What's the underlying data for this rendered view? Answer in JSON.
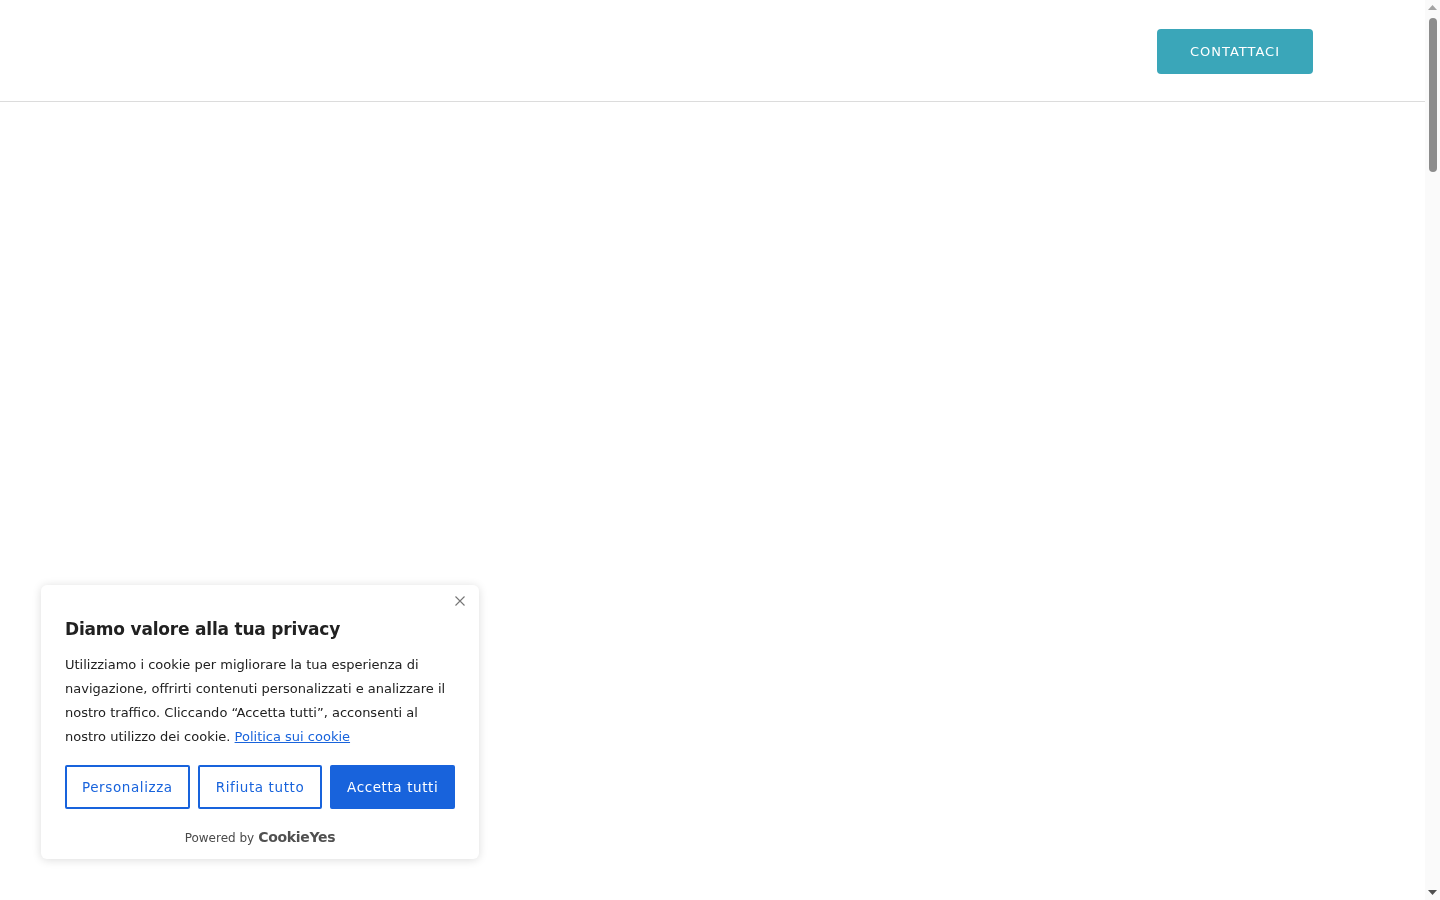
{
  "header": {
    "contact_button": "CONTATTACI"
  },
  "cookie_banner": {
    "title": "Diamo valore alla tua privacy",
    "text": "Utilizziamo i cookie per migliorare la tua esperienza di navigazione, offrirti contenuti personalizzati e analizzare il nostro traffico. Cliccando “Accetta tutti”, acconsenti al nostro utilizzo dei cookie.",
    "link": "Politica sui cookie",
    "buttons": [
      {
        "label": "Personalizza",
        "kind": "outline"
      },
      {
        "label": "Rifiuta tutto",
        "kind": "outline"
      },
      {
        "label": "Accetta tutti",
        "kind": "primary"
      }
    ],
    "powered_by": "Powered by",
    "brand": "CookieYes"
  }
}
